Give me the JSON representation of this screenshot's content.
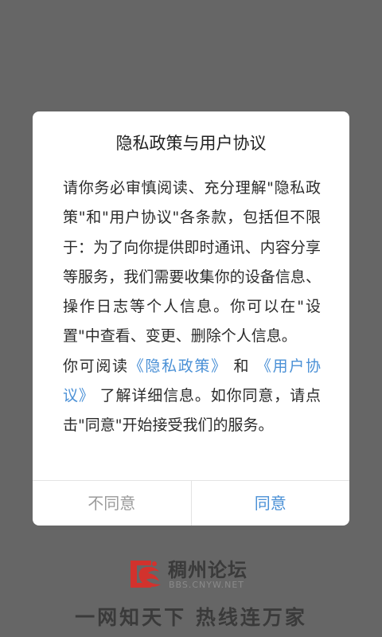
{
  "dialog": {
    "title": "隐私政策与用户协议",
    "paragraph1": "请你务必审慎阅读、充分理解\"隐私政策\"和\"用户协议\"各条款，包括但不限于：为了向你提供即时通讯、内容分享等服务，我们需要收集你的设备信息、操作日志等个人信息。你可以在\"设置\"中查看、变更、删除个人信息。",
    "paragraph2": {
      "prefix": "你可阅读",
      "privacy_link": "《隐私政策》",
      "conjunction": "和",
      "agreement_link": "《用户协议》",
      "suffix": "了解详细信息。如你同意，请点击\"同意\"开始接受我们的服务。"
    },
    "buttons": {
      "disagree": "不同意",
      "agree": "同意"
    }
  },
  "branding": {
    "name": "稠州论坛",
    "url": "BBS.CNYW.NET",
    "slogan": "一网知天下 热线连万家"
  },
  "colors": {
    "overlay": "#666666",
    "link": "#4a90d6",
    "disagree_text": "#9b9b9b",
    "logo_red": "#d2322d"
  },
  "icons": {
    "logo": "cnyw-logo-icon"
  }
}
